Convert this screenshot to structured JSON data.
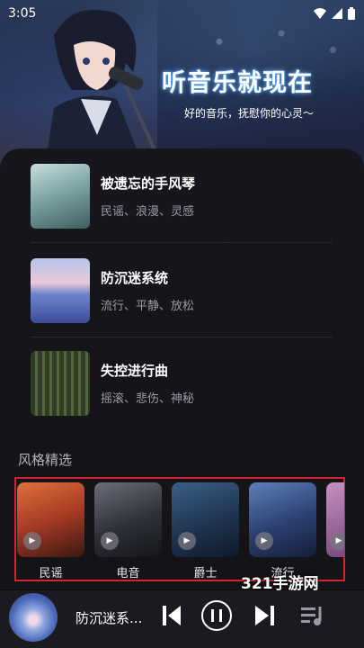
{
  "status": {
    "time": "3:05"
  },
  "banner": {
    "title": "听音乐就现在",
    "subtitle": "好的音乐，抚慰你的心灵～"
  },
  "tracks": [
    {
      "title": "被遗忘的手风琴",
      "tags": "民谣、浪漫、灵感"
    },
    {
      "title": "防沉迷系统",
      "tags": "流行、平静、放松"
    },
    {
      "title": "失控进行曲",
      "tags": "摇滚、悲伤、神秘"
    }
  ],
  "genres_section": {
    "title": "风格精选",
    "items": [
      {
        "label": "民谣"
      },
      {
        "label": "电音"
      },
      {
        "label": "爵士"
      },
      {
        "label": "流行"
      }
    ]
  },
  "watermark": "321手游网",
  "player": {
    "song": "防沉迷系..."
  },
  "colors": {
    "accent_frame": "#d8222c",
    "background": "#0b0b10"
  },
  "icons": [
    "wifi-icon",
    "signal-icon",
    "battery-icon",
    "play-icon",
    "previous-icon",
    "pause-icon",
    "next-icon",
    "playlist-icon"
  ]
}
